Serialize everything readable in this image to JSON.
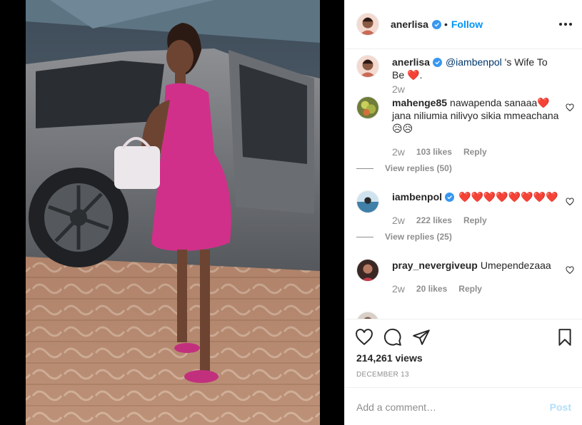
{
  "header": {
    "username": "anerlisa",
    "dot": "•",
    "follow_label": "Follow"
  },
  "caption": {
    "username": "anerlisa",
    "mention": "@iambenpol",
    "text": "'s Wife To Be ❤️.",
    "time": "2w"
  },
  "comments": [
    {
      "username": "mahenge85",
      "text": "nawapenda sanaaa❤️ jana niliumia nilivyo sikia mmeachana😥😥",
      "time": "2w",
      "likes": "103 likes",
      "reply_label": "Reply",
      "view_replies": "View replies (50)"
    },
    {
      "username": "iambenpol",
      "text": "❤️❤️❤️❤️❤️❤️❤️❤️",
      "time": "2w",
      "likes": "222 likes",
      "reply_label": "Reply",
      "view_replies": "View replies (25)"
    },
    {
      "username": "pray_nevergiveup",
      "text": "Umependezaaa",
      "time": "2w",
      "likes": "20 likes",
      "reply_label": "Reply"
    }
  ],
  "stats": {
    "views": "214,261 views",
    "date": "DECEMBER 13"
  },
  "add_comment": {
    "placeholder": "Add a comment…",
    "post_label": "Post"
  },
  "colors": {
    "link_blue": "#0095f6",
    "mention": "#00376b",
    "muted": "#8e8e8e",
    "dress_pink": "#d0308a"
  },
  "icons": {
    "more": "more-options-icon",
    "like": "heart-icon",
    "comment": "comment-icon",
    "share": "share-icon",
    "save": "bookmark-icon",
    "verified": "verified-badge-icon"
  }
}
